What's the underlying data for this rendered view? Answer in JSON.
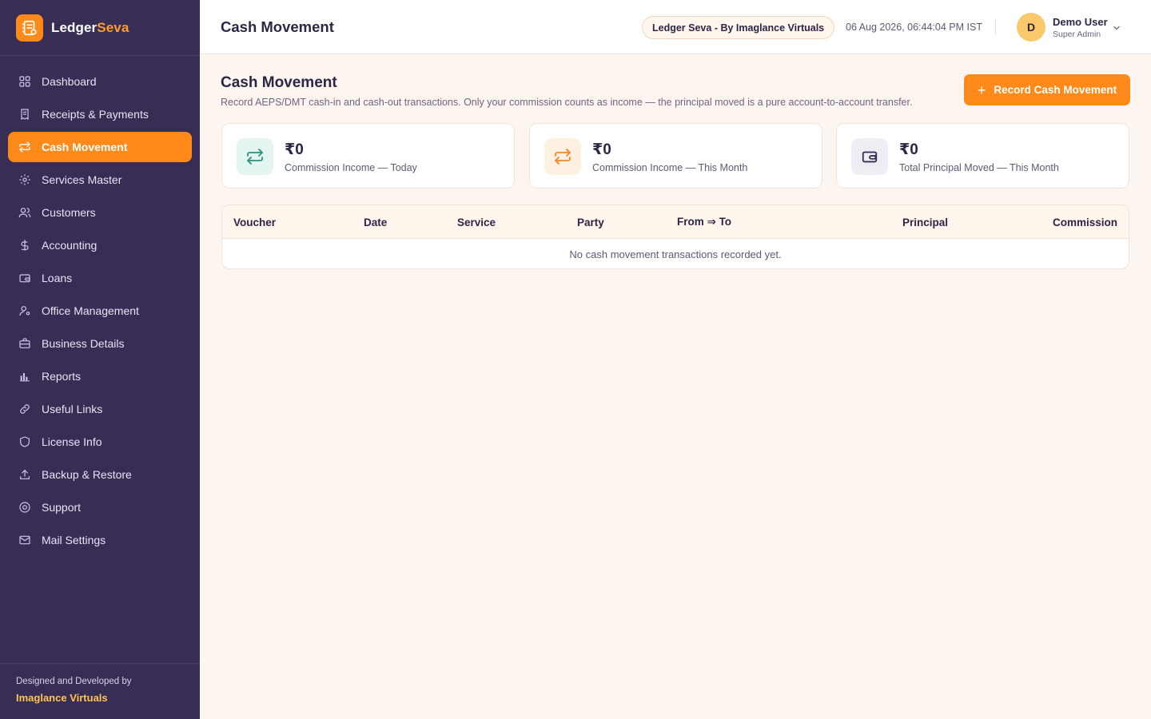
{
  "brand": {
    "name_main": "Ledger",
    "name_accent": "Seva",
    "logo_icon": "ledger-book-icon"
  },
  "sidebar": {
    "items": [
      {
        "label": "Dashboard",
        "icon": "grid-icon",
        "active": false
      },
      {
        "label": "Receipts & Payments",
        "icon": "receipt-icon",
        "active": false
      },
      {
        "label": "Cash Movement",
        "icon": "transfer-icon",
        "active": true
      },
      {
        "label": "Services Master",
        "icon": "gear-icon",
        "active": false
      },
      {
        "label": "Customers",
        "icon": "users-icon",
        "active": false
      },
      {
        "label": "Accounting",
        "icon": "dollar-icon",
        "active": false
      },
      {
        "label": "Loans",
        "icon": "wallet-icon",
        "active": false
      },
      {
        "label": "Office Management",
        "icon": "user-cog-icon",
        "active": false
      },
      {
        "label": "Business Details",
        "icon": "briefcase-icon",
        "active": false
      },
      {
        "label": "Reports",
        "icon": "bar-chart-icon",
        "active": false
      },
      {
        "label": "Useful Links",
        "icon": "link-icon",
        "active": false
      },
      {
        "label": "License Info",
        "icon": "shield-icon",
        "active": false
      },
      {
        "label": "Backup & Restore",
        "icon": "upload-icon",
        "active": false
      },
      {
        "label": "Support",
        "icon": "help-circle-icon",
        "active": false
      },
      {
        "label": "Mail Settings",
        "icon": "mail-icon",
        "active": false
      }
    ],
    "footer_caption": "Designed and Developed by",
    "footer_company": "Imaglance Virtuals"
  },
  "header": {
    "title": "Cash Movement",
    "org_pill": "Ledger Seva - By Imaglance Virtuals",
    "datetime": "06 Aug 2026, 06:44:04 PM IST",
    "user": {
      "initial": "D",
      "name": "Demo User",
      "role": "Super Admin"
    }
  },
  "main": {
    "heading": "Cash Movement",
    "description": "Record AEPS/DMT cash-in and cash-out transactions. Only your commission counts as income — the principal moved is a pure account-to-account transfer.",
    "primary_button": {
      "label": "Record Cash Movement",
      "icon": "plus-icon"
    },
    "stats": [
      {
        "value": "₹0",
        "label": "Commission Income — Today",
        "icon": "transfer-icon",
        "color": "#2f8f7a",
        "bg": "#e3f5f0"
      },
      {
        "value": "₹0",
        "label": "Commission Income — This Month",
        "icon": "transfer-icon",
        "color": "#f08a24",
        "bg": "#fff0e2"
      },
      {
        "value": "₹0",
        "label": "Total Principal Moved — This Month",
        "icon": "wallet-icon",
        "color": "#372d55",
        "bg": "#eeedf3"
      }
    ],
    "table": {
      "columns": [
        "Voucher",
        "Date",
        "Service",
        "Party",
        "From ⇒ To",
        "Principal",
        "Commission"
      ],
      "empty_message": "No cash movement transactions recorded yet."
    }
  },
  "colors": {
    "accent": "#ff8a1a",
    "sidebar": "#372d55",
    "page_bg": "#fdf6f0",
    "footer_company": "#ffc54d"
  }
}
